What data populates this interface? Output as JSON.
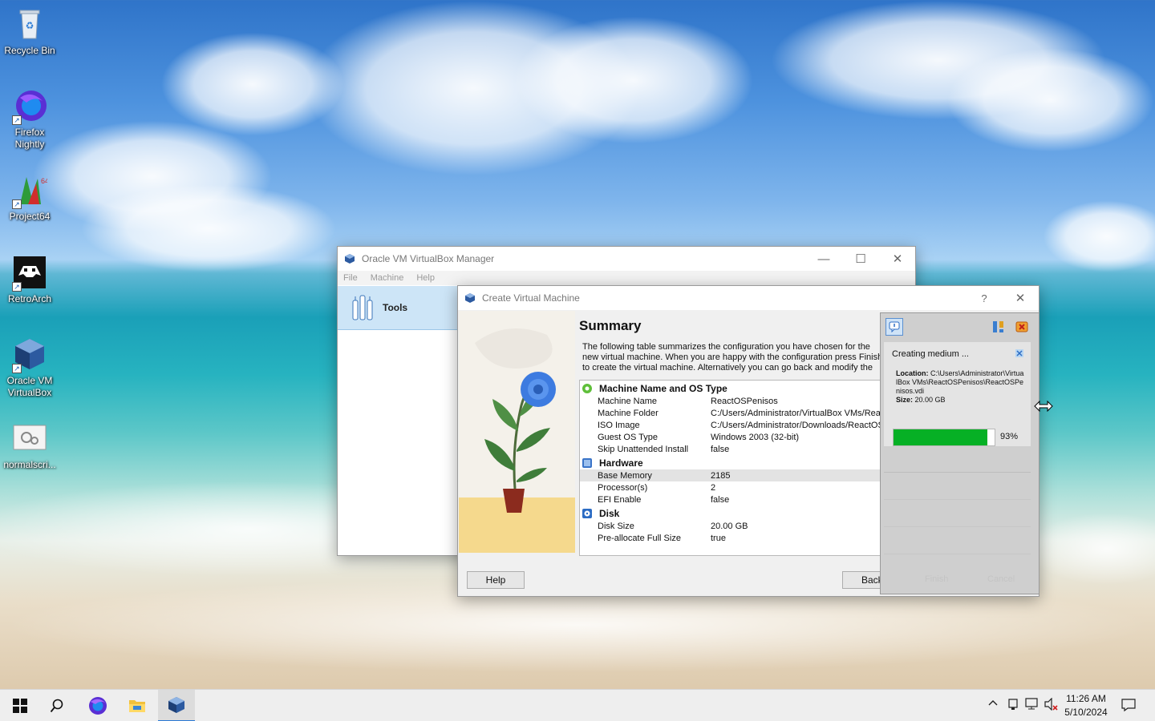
{
  "desktop": {
    "icons": [
      {
        "label": "Recycle Bin"
      },
      {
        "label": "Firefox Nightly"
      },
      {
        "label": "Project64"
      },
      {
        "label": "RetroArch"
      },
      {
        "label": "Oracle VM VirtualBox"
      },
      {
        "label": "normalscri..."
      }
    ]
  },
  "vbox_manager": {
    "title": "Oracle VM VirtualBox Manager",
    "menu": [
      "File",
      "Machine",
      "Help"
    ],
    "tools_label": "Tools",
    "controls": {
      "minimize": "—",
      "maximize": "☐",
      "close": "✕"
    }
  },
  "create_vm": {
    "title": "Create Virtual Machine",
    "help_glyph": "?",
    "close_glyph": "✕",
    "heading": "Summary",
    "description": "The following table summarizes the configuration you have chosen for the new virtual machine. When you are happy with the configuration press Finish to create the virtual machine. Alternatively you can go back and modify the configuration.",
    "sections": [
      {
        "title": "Machine Name and OS Type",
        "icon": "os-type-icon",
        "rows": [
          {
            "key": "Machine Name",
            "value": "ReactOSPenisos"
          },
          {
            "key": "Machine Folder",
            "value": "C:/Users/Administrator/VirtualBox VMs/ReactOSPenisos"
          },
          {
            "key": "ISO Image",
            "value": "C:/Users/Administrator/Downloads/ReactOS.iso"
          },
          {
            "key": "Guest OS Type",
            "value": "Windows 2003 (32-bit)"
          },
          {
            "key": "Skip Unattended Install",
            "value": "false"
          }
        ]
      },
      {
        "title": "Hardware",
        "icon": "hardware-icon",
        "rows": [
          {
            "key": "Base Memory",
            "value": "2185"
          },
          {
            "key": "Processor(s)",
            "value": "2"
          },
          {
            "key": "EFI Enable",
            "value": "false"
          }
        ]
      },
      {
        "title": "Disk",
        "icon": "disk-icon",
        "rows": [
          {
            "key": "Disk Size",
            "value": "20.00 GB"
          },
          {
            "key": "Pre-allocate Full Size",
            "value": "true"
          }
        ]
      }
    ],
    "buttons": {
      "help": "Help",
      "back": "Back",
      "finish": "Finish",
      "cancel": "Cancel"
    }
  },
  "progress": {
    "title": "Creating medium ...",
    "location_label": "Location:",
    "location_value": "C:\\Users\\Administrator\\VirtualBox VMs\\ReactOSPenisos\\ReactOSPenisos.vdi",
    "size_label": "Size:",
    "size_value": "20.00 GB",
    "percent_text": "93%",
    "percent": 93,
    "fill_color": "#06b025"
  },
  "taskbar": {
    "time": "11:26 AM",
    "date": "5/10/2024",
    "apps": [
      "start-icon",
      "search-icon",
      "firefox-nightly-icon",
      "file-explorer-icon",
      "virtualbox-icon"
    ]
  }
}
